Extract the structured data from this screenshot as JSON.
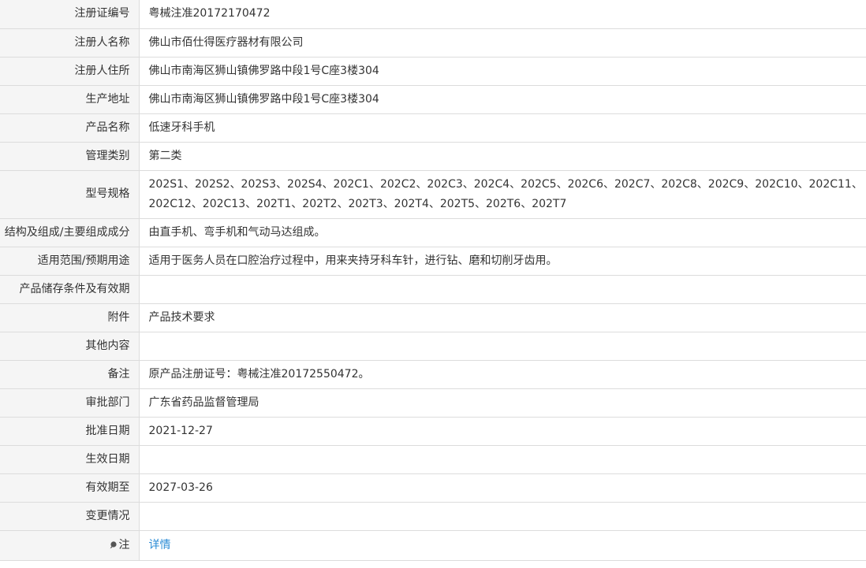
{
  "rows": [
    {
      "label": "注册证编号",
      "value": "粤械注准20172170472"
    },
    {
      "label": "注册人名称",
      "value": "佛山市佰仕得医疗器材有限公司"
    },
    {
      "label": "注册人住所",
      "value": "佛山市南海区狮山镇佛罗路中段1号C座3楼304"
    },
    {
      "label": "生产地址",
      "value": "佛山市南海区狮山镇佛罗路中段1号C座3楼304"
    },
    {
      "label": "产品名称",
      "value": "低速牙科手机"
    },
    {
      "label": "管理类别",
      "value": "第二类"
    },
    {
      "label": "型号规格",
      "value": "202S1、202S2、202S3、202S4、202C1、202C2、202C3、202C4、202C5、202C6、202C7、202C8、202C9、202C10、202C11、202C12、202C13、202T1、202T2、202T3、202T4、202T5、202T6、202T7"
    },
    {
      "label": "结构及组成/主要组成成分",
      "value": "由直手机、弯手机和气动马达组成。"
    },
    {
      "label": "适用范围/预期用途",
      "value": "适用于医务人员在口腔治疗过程中，用来夹持牙科车针，进行钻、磨和切削牙齿用。"
    },
    {
      "label": "产品储存条件及有效期",
      "value": ""
    },
    {
      "label": "附件",
      "value": "产品技术要求"
    },
    {
      "label": "其他内容",
      "value": ""
    },
    {
      "label": "备注",
      "value": "原产品注册证号：粤械注准20172550472。"
    },
    {
      "label": "审批部门",
      "value": "广东省药品监督管理局"
    },
    {
      "label": "批准日期",
      "value": "2021-12-27"
    },
    {
      "label": "生效日期",
      "value": ""
    },
    {
      "label": "有效期至",
      "value": "2027-03-26"
    },
    {
      "label": "变更情况",
      "value": ""
    }
  ],
  "note": {
    "label": "注",
    "icon": "pin-icon",
    "link_text": "详情"
  },
  "colors": {
    "label_bg": "#f5f5f5",
    "border": "#dcdcdc",
    "text": "#333333",
    "link": "#2a8bd5"
  }
}
